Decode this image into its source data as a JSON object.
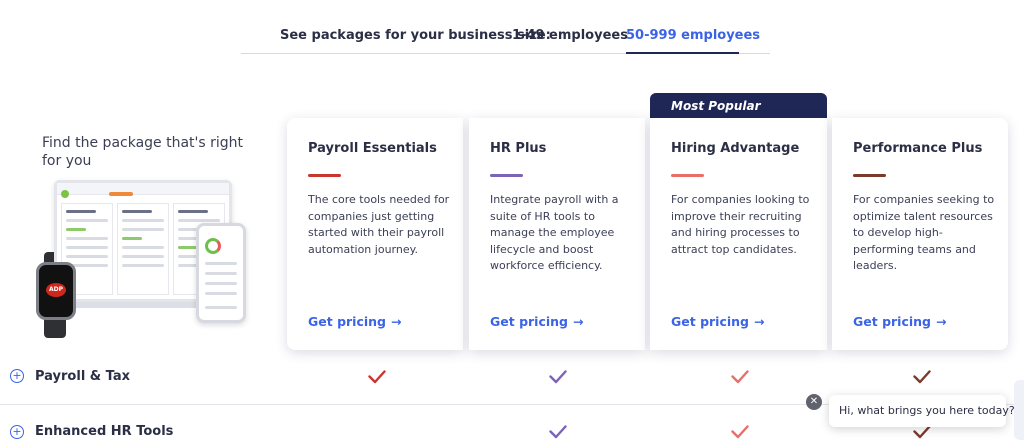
{
  "size_selector": {
    "label": "See packages for your business size:",
    "tabs": [
      {
        "label": "1-49 employees",
        "active": false
      },
      {
        "label": "50-999 employees",
        "active": true
      }
    ]
  },
  "intro": {
    "title": "Find the package that's right for you"
  },
  "illustration": {
    "watch_logo": "ADP"
  },
  "popular_tag": "Most Popular",
  "plans": [
    {
      "name": "Payroll Essentials",
      "accent": "#c8362f",
      "description": "The core tools needed for companies just getting started with their payroll automation journey.",
      "cta": "Get pricing",
      "cta_icon": "arrow-right-icon"
    },
    {
      "name": "HR Plus",
      "accent": "#7a63b8",
      "description": "Integrate payroll with a suite of HR tools to manage the employee lifecycle and boost workforce efficiency.",
      "cta": "Get pricing",
      "cta_icon": "arrow-right-icon"
    },
    {
      "name": "Hiring Advantage",
      "accent": "#e5706a",
      "description": "For companies looking to improve their recruiting and hiring processes to attract top candidates.",
      "cta": "Get pricing",
      "cta_icon": "arrow-right-icon"
    },
    {
      "name": "Performance Plus",
      "accent": "#7a3b2a",
      "description": "For companies seeking to optimize talent resources to develop high-performing teams and leaders.",
      "cta": "Get pricing",
      "cta_icon": "arrow-right-icon"
    }
  ],
  "features": [
    {
      "label": "Payroll & Tax",
      "included": [
        true,
        true,
        true,
        true
      ]
    },
    {
      "label": "Enhanced HR Tools",
      "included": [
        false,
        true,
        true,
        true
      ]
    }
  ],
  "chat": {
    "message": "Hi, what brings you here today?",
    "close_icon": "close-icon"
  },
  "colors": {
    "accent_blue": "#3b63e6",
    "navy": "#1f2756"
  }
}
